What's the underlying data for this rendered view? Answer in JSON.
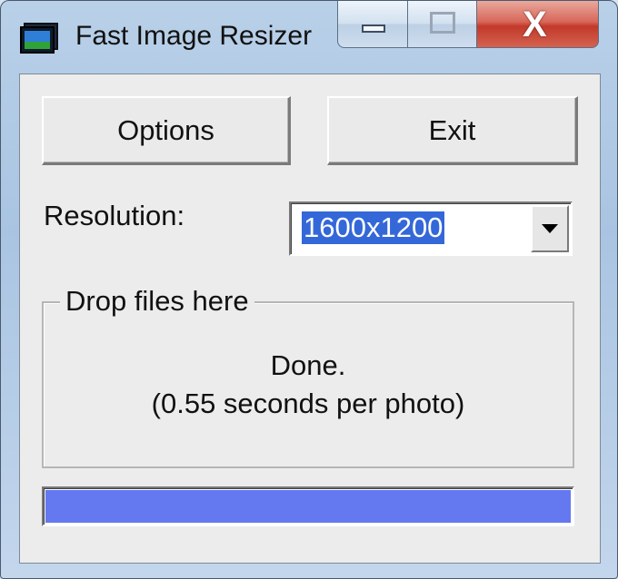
{
  "window": {
    "title": "Fast Image Resizer",
    "icon": "app-image-icon",
    "caption_buttons": {
      "minimize_icon": "minimize-icon",
      "maximize_icon": "maximize-icon",
      "close_label": "X"
    }
  },
  "buttons": {
    "options_label": "Options",
    "exit_label": "Exit"
  },
  "resolution": {
    "label": "Resolution:",
    "selected": "1600x1200"
  },
  "drop_zone": {
    "legend": "Drop files here",
    "status_line1": "Done.",
    "status_line2": "(0.55 seconds per photo)"
  },
  "progress": {
    "fraction": 1.0,
    "fill_color": "#6478f0"
  },
  "colors": {
    "selection_highlight": "#3468d8",
    "close_button": "#c2392a"
  }
}
